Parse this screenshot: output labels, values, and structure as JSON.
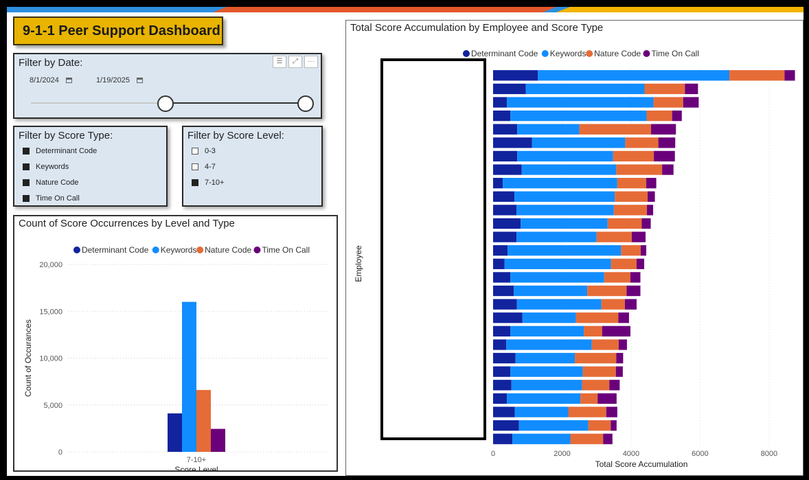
{
  "dashboard": {
    "title": "9-1-1 Peer Support Dashboard",
    "colors": {
      "accent": "#e8b400",
      "stripe_blue": "#2d8fdf",
      "stripe_orange": "#e4582b",
      "panel_bg": "#dbe6f1"
    }
  },
  "date_filter": {
    "title": "Filter by Date:",
    "start_date": "8/1/2024",
    "end_date": "1/19/2025",
    "icons": [
      "filter-icon",
      "focus-mode-icon",
      "more-options-icon"
    ],
    "slider_range": [
      0.49,
      1.0
    ]
  },
  "score_type_filter": {
    "title": "Filter by Score Type:",
    "items": [
      {
        "label": "Determinant Code",
        "checked": true
      },
      {
        "label": "Keywords",
        "checked": true
      },
      {
        "label": "Nature Code",
        "checked": true
      },
      {
        "label": "Time On Call",
        "checked": true
      }
    ]
  },
  "score_level_filter": {
    "title": "Filter by Score Level:",
    "items": [
      {
        "label": "0-3",
        "checked": false
      },
      {
        "label": "4-7",
        "checked": false
      },
      {
        "label": "7-10+",
        "checked": true
      }
    ]
  },
  "chart_data": [
    {
      "type": "bar",
      "title": "Count of Score Occurrences by Level and Type",
      "xlabel": "Score Level",
      "ylabel": "Count of Occurances",
      "categories": [
        "7-10+"
      ],
      "series": [
        {
          "name": "Determinant Code",
          "color": "#12239e",
          "values": [
            4100
          ]
        },
        {
          "name": "Keywords",
          "color": "#118dff",
          "values": [
            16000
          ]
        },
        {
          "name": "Nature Code",
          "color": "#e66c37",
          "values": [
            6600
          ]
        },
        {
          "name": "Time On Call",
          "color": "#6b007b",
          "values": [
            2450
          ]
        }
      ],
      "ylim": [
        0,
        20000
      ],
      "yticks": [
        "20,000",
        "15,000",
        "10,000",
        "5,000",
        "0"
      ],
      "ytick_values": [
        20000,
        15000,
        10000,
        5000,
        0
      ],
      "legend_position": "top",
      "grid": true
    },
    {
      "type": "bar",
      "orientation": "horizontal",
      "stacked": true,
      "title": "Total Score Accumulation by Employee and Score Type",
      "xlabel": "Total Score Accumulation",
      "ylabel": "Employee",
      "legend_position": "top",
      "grid": true,
      "xlim": [
        0,
        8600
      ],
      "xticks": [
        "0",
        "2000",
        "4000",
        "6000",
        "8000"
      ],
      "xtick_values": [
        0,
        2000,
        4000,
        6000,
        8000
      ],
      "series": [
        {
          "name": "Determinant Code",
          "color": "#12239e",
          "values": [
            1300,
            950,
            400,
            500,
            700,
            1130,
            700,
            830,
            280,
            620,
            680,
            800,
            680,
            420,
            330,
            500,
            600,
            690,
            850,
            500,
            380,
            650,
            500,
            530,
            400,
            630,
            750,
            560
          ]
        },
        {
          "name": "Keywords",
          "color": "#118dff",
          "values": [
            5550,
            3440,
            4250,
            3950,
            1800,
            2700,
            2780,
            2740,
            3320,
            2910,
            2820,
            2520,
            2320,
            3290,
            3090,
            2720,
            2130,
            2450,
            1550,
            2130,
            2480,
            1720,
            2100,
            2050,
            2130,
            1550,
            2010,
            1680
          ]
        },
        {
          "name": "Nature Code",
          "color": "#e66c37",
          "values": [
            1600,
            1170,
            860,
            740,
            2080,
            960,
            1180,
            1330,
            840,
            950,
            960,
            990,
            1020,
            570,
            740,
            760,
            1140,
            680,
            1230,
            530,
            780,
            1200,
            960,
            790,
            500,
            1100,
            650,
            950
          ]
        },
        {
          "name": "Time On Call",
          "color": "#6b007b",
          "values": [
            300,
            380,
            450,
            280,
            720,
            490,
            610,
            330,
            290,
            210,
            180,
            260,
            400,
            160,
            220,
            290,
            400,
            340,
            310,
            820,
            240,
            200,
            200,
            300,
            550,
            320,
            170,
            270
          ]
        }
      ]
    }
  ]
}
